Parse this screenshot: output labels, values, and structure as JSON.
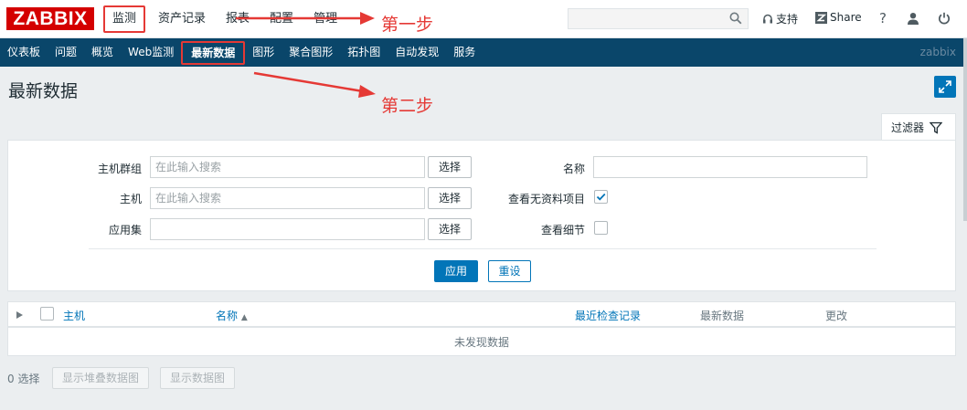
{
  "header": {
    "logo": "ZABBIX",
    "menu": [
      "监测",
      "资产记录",
      "报表",
      "配置",
      "管理"
    ],
    "search": {
      "placeholder": "",
      "icon": "search-icon"
    },
    "support_label": "支持",
    "share_label": "Share",
    "help_label": "?",
    "icons": {
      "user": "user-icon",
      "logout": "power-icon",
      "support": "headset-icon",
      "share": "share-z-icon"
    }
  },
  "nav": {
    "items": [
      "仪表板",
      "问题",
      "概览",
      "Web监测",
      "最新数据",
      "图形",
      "聚合图形",
      "拓扑图",
      "自动发现",
      "服务"
    ],
    "brand": "zabbix"
  },
  "page": {
    "title": "最新数据"
  },
  "annotations": {
    "step1": "第一步",
    "step2": "第二步"
  },
  "filter": {
    "tab_label": "过滤器",
    "host_groups_label": "主机群组",
    "host_groups_placeholder": "在此输入搜索",
    "hosts_label": "主机",
    "hosts_placeholder": "在此输入搜索",
    "application_label": "应用集",
    "application_value": "",
    "name_label": "名称",
    "name_value": "",
    "show_without_data_label": "查看无资料项目",
    "show_without_data_checked": true,
    "show_details_label": "查看细节",
    "show_details_checked": false,
    "select_label": "选择",
    "apply_label": "应用",
    "reset_label": "重设"
  },
  "table": {
    "columns": {
      "host": "主机",
      "name": "名称",
      "last_check": "最近检查记录",
      "last_value": "最新数据",
      "change": "更改"
    },
    "sort_indicator": "▲",
    "empty_text": "未发现数据"
  },
  "footer": {
    "selected_count": "0 选择",
    "btn_stacked": "显示堆叠数据图",
    "btn_graph": "显示数据图"
  },
  "colors": {
    "nav_bg": "#0a466a",
    "accent": "#0275b8",
    "logo_bg": "#d40000",
    "annotation": "#e53935"
  }
}
